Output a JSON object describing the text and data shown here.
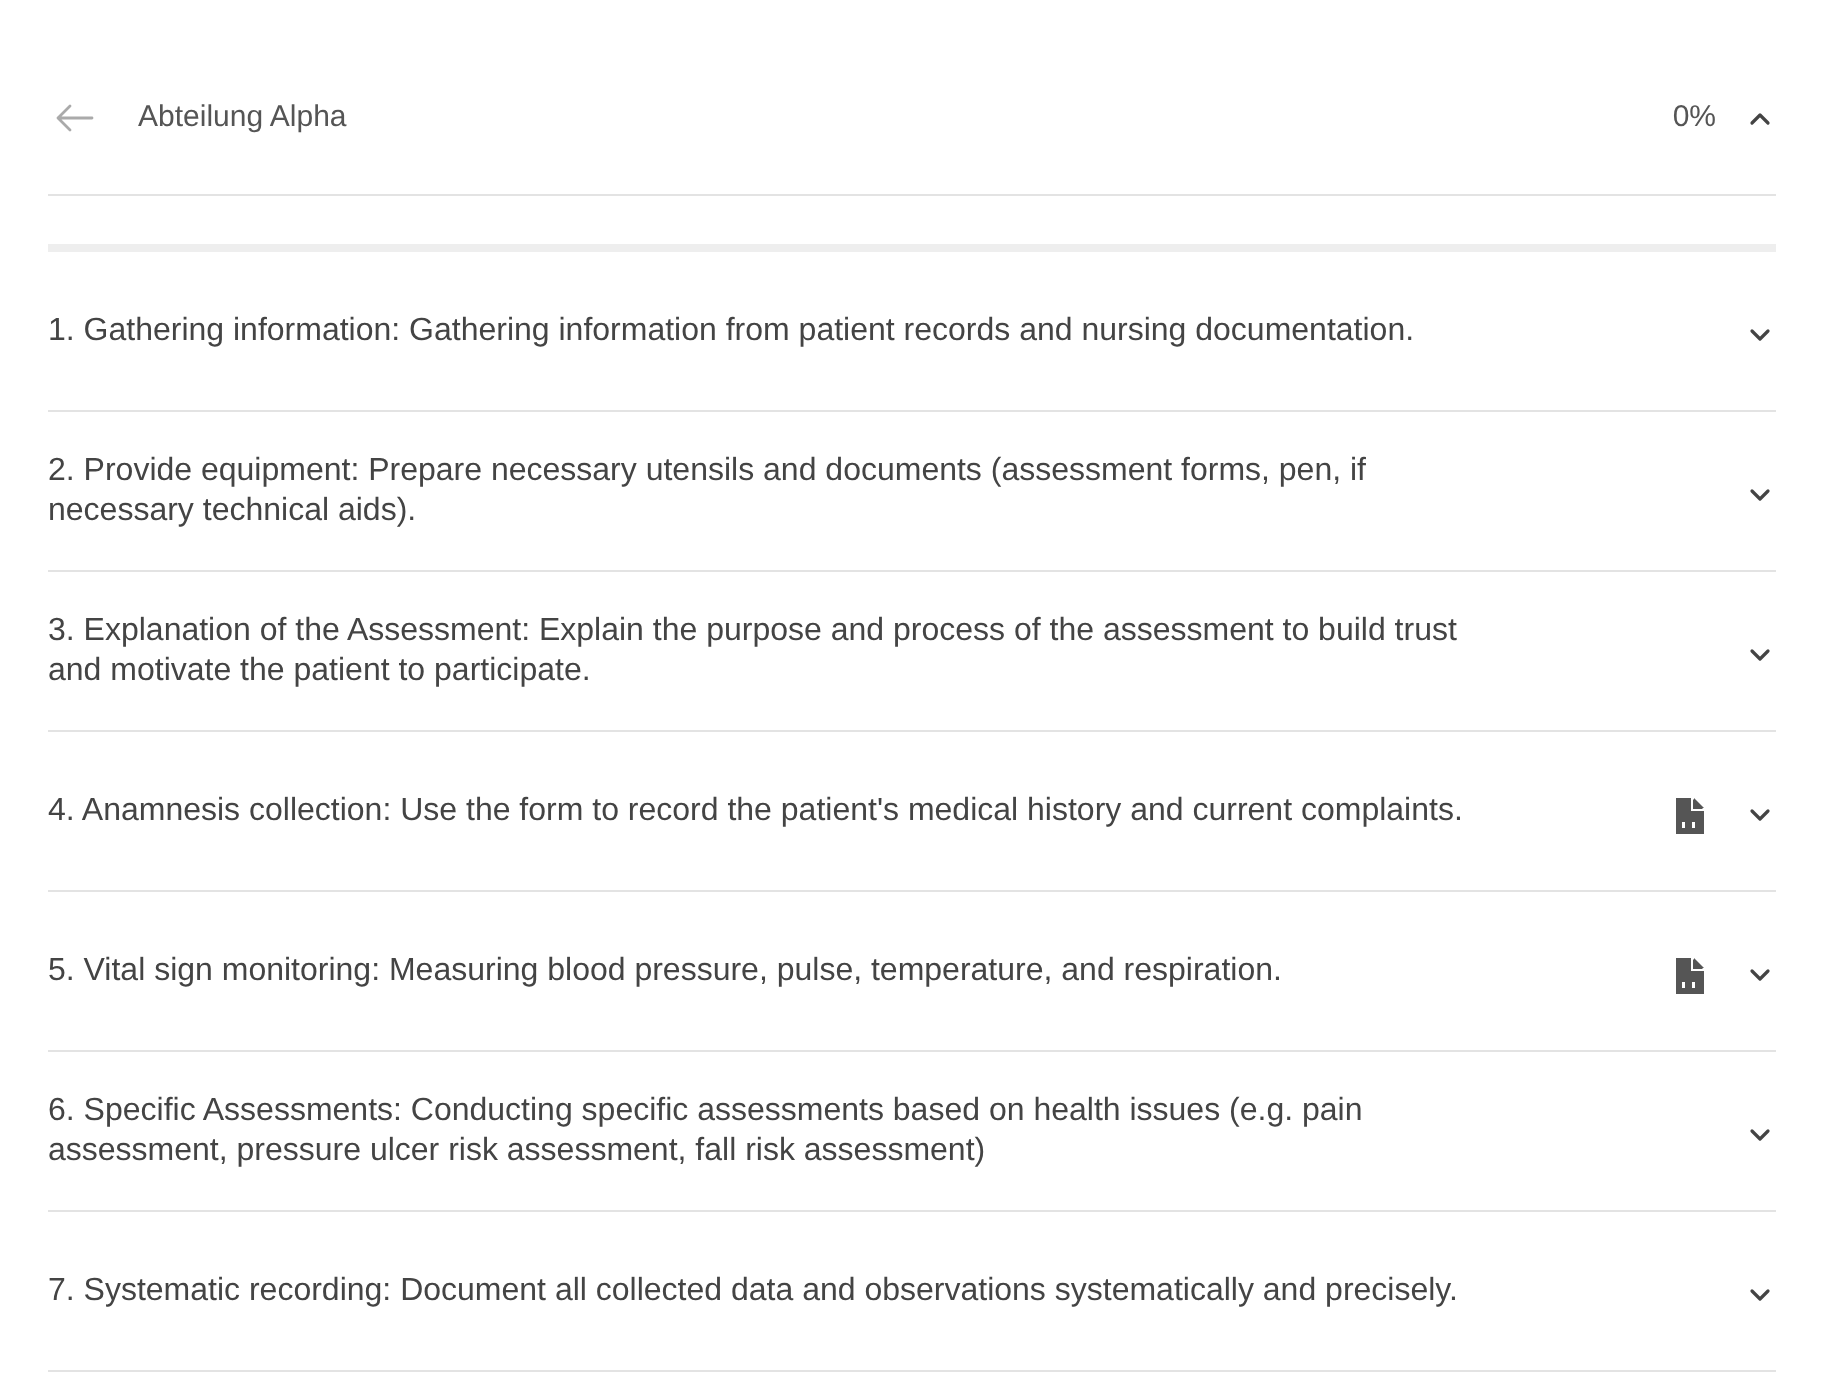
{
  "header": {
    "title": "Abteilung Alpha",
    "percent": "0%",
    "expanded": true
  },
  "progress": {
    "level": 0
  },
  "steps": [
    {
      "text": "1. Gathering information: Gathering information from patient records and nursing documentation.",
      "has_document": false,
      "expanded": false
    },
    {
      "text": "2. Provide equipment: Prepare necessary utensils and documents (assessment forms, pen, if necessary technical aids).",
      "has_document": false,
      "expanded": false
    },
    {
      "text": "3. Explanation of the Assessment: Explain the purpose and process of the assessment to build trust and motivate the patient to participate.",
      "has_document": false,
      "expanded": false
    },
    {
      "text": "4. Anamnesis collection: Use the form to record the patient's medical history and current complaints.",
      "has_document": true,
      "expanded": false
    },
    {
      "text": "5. Vital sign monitoring: Measuring blood pressure, pulse, temperature, and respiration.",
      "has_document": true,
      "expanded": false
    },
    {
      "text": "6. Specific Assessments: Conducting specific assessments based on health issues (e.g. pain assessment, pressure ulcer risk assessment, fall risk assessment)",
      "has_document": false,
      "expanded": false
    },
    {
      "text": "7. Systematic recording: Document all collected data and observations systematically and precisely.",
      "has_document": false,
      "expanded": false
    }
  ]
}
